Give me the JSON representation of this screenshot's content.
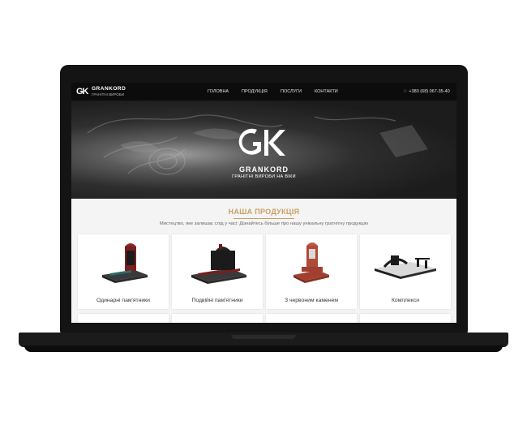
{
  "brand": {
    "mark": "GK",
    "name": "GRANKORD",
    "tagline": "ГРАНІТНІ ВИРОБИ НА ВІКИ",
    "nav_tagline": "ГРАНІТНІ ВИРОБИ"
  },
  "nav": {
    "links": [
      "ГОЛОВНА",
      "ПРОДУКЦІЯ",
      "ПОСЛУГИ",
      "КОНТАКТИ"
    ],
    "phone": "+380 (68) 067-35-40",
    "phone_icon": "phone-icon"
  },
  "section": {
    "title": "НАША ПРОДУКЦІЯ",
    "subtitle": "Мистецтво, яке залишає слід у часі: Дізнайтесь більше про нашу унікальну гратнітну продукцію"
  },
  "products": [
    {
      "label": "Одинарні пам'ятники"
    },
    {
      "label": "Подвійні пам'ятники"
    },
    {
      "label": "З червоним каменем"
    },
    {
      "label": "Комплекси"
    }
  ],
  "colors": {
    "accent": "#c8a063",
    "nav_bg": "#0c0c0c",
    "link": "#4a90e2"
  }
}
